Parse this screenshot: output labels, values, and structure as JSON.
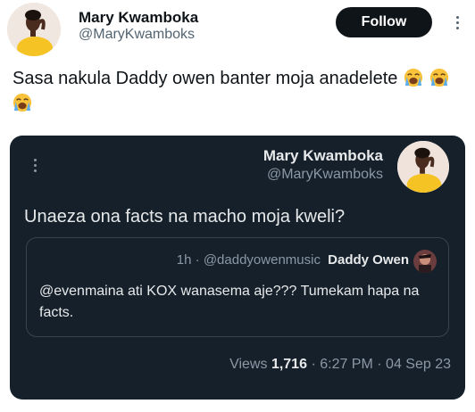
{
  "header": {
    "name": "Mary Kwamboka",
    "handle": "@MaryKwamboks",
    "follow_label": "Follow"
  },
  "tweet": {
    "text": "Sasa nakula Daddy owen banter moja anadelete",
    "emoji": "loudly-crying-face",
    "emoji_count": 3
  },
  "embed": {
    "name": "Mary Kwamboka",
    "handle": "@MaryKwamboks",
    "text": "Unaeza ona facts  na macho moja kweli?",
    "quote": {
      "time": "1h",
      "separator": "·",
      "handle": "@daddyowenmusic",
      "name": "Daddy Owen",
      "text": "@evenmaina ati KOX wanasema aje??? Tumekam hapa na facts."
    },
    "stats": {
      "views_label": "Views",
      "views_count": "1,716",
      "time": "6:27 PM",
      "date": "04 Sep 23",
      "separator": "·"
    }
  },
  "colors": {
    "follow_bg": "#0f1419",
    "card_bg": "#15202b",
    "secondary_text": "#536471",
    "dark_secondary": "#8b98a5"
  }
}
